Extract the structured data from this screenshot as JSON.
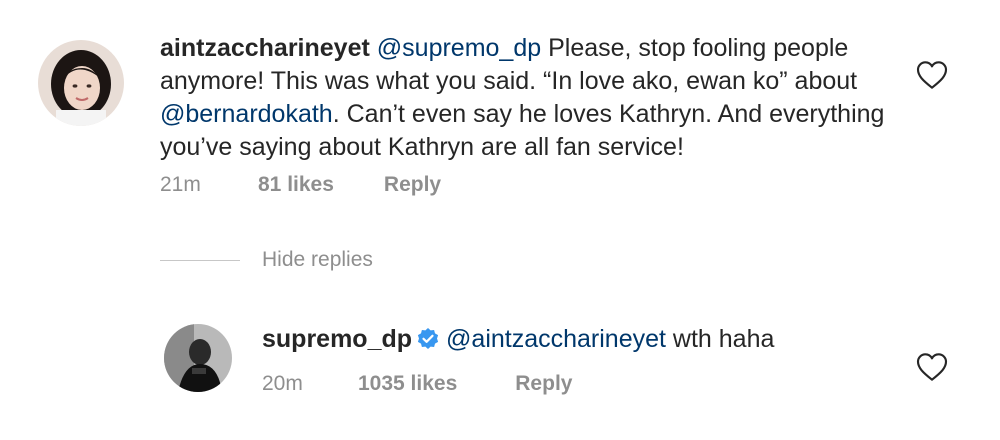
{
  "comment": {
    "username": "aintzaccharineyet",
    "mention1": "@supremo_dp",
    "text1": " Please, stop fooling people anymore! This was what you said. “In love ako, ewan ko” about ",
    "mention2": "@bernardokath",
    "text2": ". Can’t even say he loves Kathryn. And everything you’ve saying about Kathryn are all fan service!",
    "time": "21m",
    "likes": "81 likes",
    "reply_label": "Reply"
  },
  "thread": {
    "toggle_label": "Hide replies"
  },
  "reply": {
    "username": "supremo_dp",
    "mention": "@aintzaccharineyet",
    "text": " wth haha",
    "time": "20m",
    "likes": "1035 likes",
    "reply_label": "Reply"
  },
  "icons": {
    "heart": "heart-outline-icon",
    "verified": "verified-badge-icon"
  },
  "colors": {
    "mention": "#00376b",
    "verified": "#3897f0",
    "muted": "#8e8e8e"
  }
}
